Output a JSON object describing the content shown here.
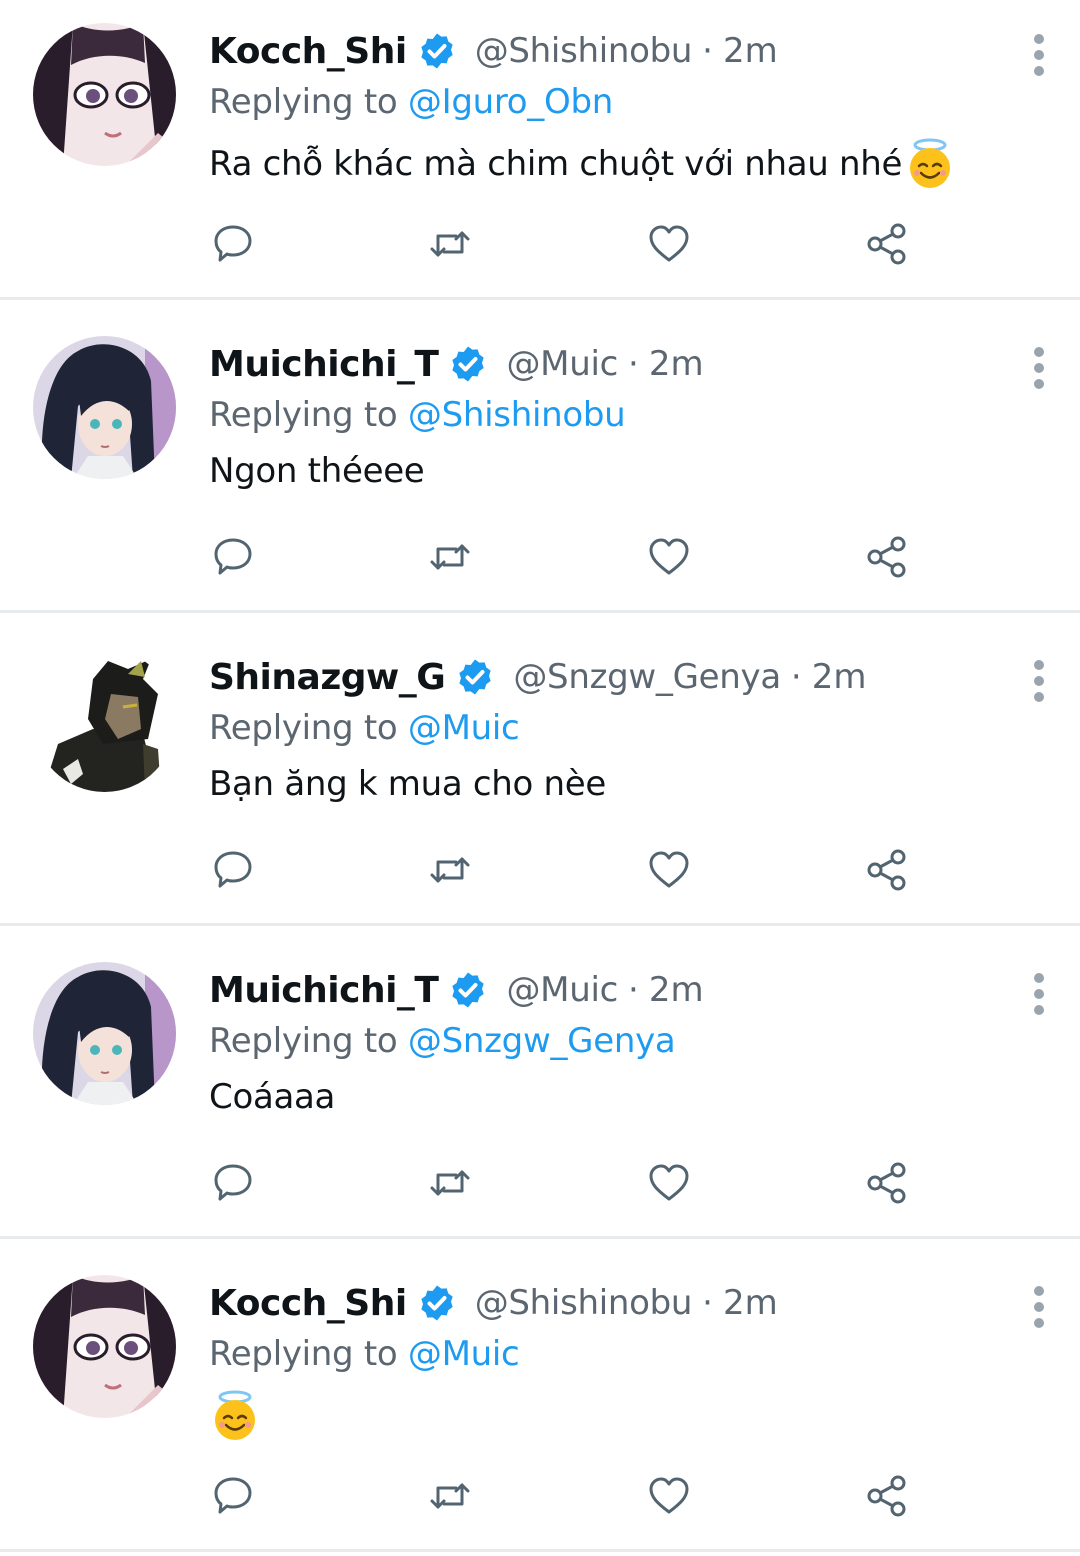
{
  "tweets": [
    {
      "name": "Kocch_Shi",
      "handle": "@Shishinobu",
      "separator": "·",
      "time": "2m",
      "replying_prefix": "Replying to",
      "replying_to": "@Iguro_Obn",
      "text": "Ra chỗ khác mà chim chuột với nhau nhé",
      "emoji": "smiling-face-with-halo"
    },
    {
      "name": "Muichichi_T",
      "handle": "@Muic",
      "separator": "·",
      "time": "2m",
      "replying_prefix": "Replying to",
      "replying_to": "@Shishinobu",
      "text": "Ngon théeee",
      "emoji": ""
    },
    {
      "name": "Shinazgw_G",
      "handle": "@Snzgw_Genya",
      "separator": "·",
      "time": "2m",
      "replying_prefix": "Replying to",
      "replying_to": "@Muic",
      "text": "Bạn ăng k mua cho nèe",
      "emoji": ""
    },
    {
      "name": "Muichichi_T",
      "handle": "@Muic",
      "separator": "·",
      "time": "2m",
      "replying_prefix": "Replying to",
      "replying_to": "@Snzgw_Genya",
      "text": "Coáaaa",
      "emoji": ""
    },
    {
      "name": "Kocch_Shi",
      "handle": "@Shishinobu",
      "separator": "·",
      "time": "2m",
      "replying_prefix": "Replying to",
      "replying_to": "@Muic",
      "text": "",
      "emoji": "smiling-face-with-halo"
    }
  ],
  "icons": {
    "reply": "reply-icon",
    "retweet": "retweet-icon",
    "like": "heart-icon",
    "share": "share-icon",
    "more": "more-vertical-icon",
    "verified": "verified-badge-icon"
  },
  "colors": {
    "accent": "#1d9bf0",
    "secondary_text": "#5b6670",
    "primary_text": "#0f1419",
    "divider": "#e7ebee",
    "icon": "#536471"
  }
}
